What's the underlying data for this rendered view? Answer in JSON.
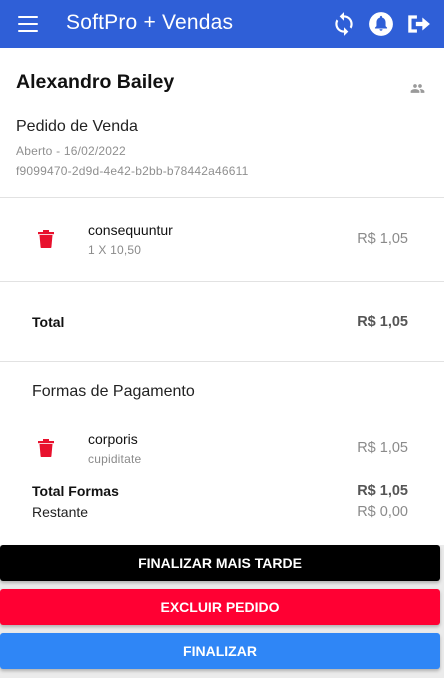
{
  "header": {
    "title": "SoftPro + Vendas",
    "bg_color": "#2f5fd7",
    "icons": [
      "menu-icon",
      "sync-icon",
      "notification-bell-icon",
      "logout-icon"
    ]
  },
  "order": {
    "customer_name": "Alexandro Bailey",
    "customer_icon": "people-icon",
    "type": "Pedido de Venda",
    "status_date": "Aberto - 16/02/2022",
    "id": "f9099470-2d9d-4e42-b2bb-b78442a46611"
  },
  "items": [
    {
      "name": "consequuntur",
      "qty_price": "1 X 10,50",
      "total": "R$ 1,05",
      "icon": "trash-icon"
    }
  ],
  "totals": {
    "label": "Total",
    "value": "R$ 1,05"
  },
  "payments": {
    "title": "Formas de Pagamento",
    "items": [
      {
        "name": "corporis",
        "detail": "cupiditate",
        "value": "R$ 1,05",
        "icon": "trash-icon"
      }
    ],
    "total_label": "Total Formas",
    "total_value": "R$ 1,05",
    "remaining_label": "Restante",
    "remaining_value": "R$ 0,00"
  },
  "actions": {
    "later": {
      "label": "FINALIZAR MAIS TARDE",
      "color": "#000000"
    },
    "delete": {
      "label": "EXCLUIR PEDIDO",
      "color": "#ff0033"
    },
    "finish": {
      "label": "FINALIZAR",
      "color": "#2f86f6"
    }
  },
  "colors": {
    "trash": "#e8112d",
    "muted_text": "#8a8a8a"
  }
}
